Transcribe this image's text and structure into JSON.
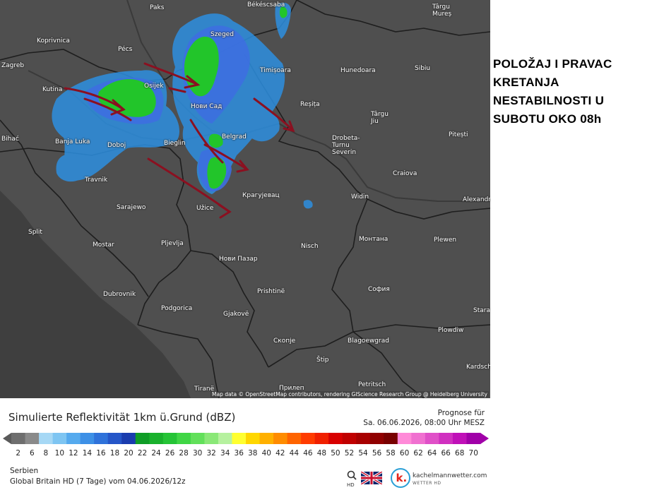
{
  "headline": [
    "POLOŽAJ I PRAVAC",
    "KRETANJA",
    "NESTABILNOSTI U",
    "SUBOTU OKO 08h"
  ],
  "map": {
    "attribution": "Map data © OpenStreetMap contributors, rendering GIScience Research Group @ Heidelberg University",
    "cities": [
      {
        "name": "Paks"
      },
      {
        "name": "Békéscsaba"
      },
      {
        "name": "Târgu Mureș"
      },
      {
        "name": "Koprivnica"
      },
      {
        "name": "Pécs"
      },
      {
        "name": "Szeged"
      },
      {
        "name": "Zagreb"
      },
      {
        "name": "Timișoara"
      },
      {
        "name": "Hunedoara"
      },
      {
        "name": "Sibiu"
      },
      {
        "name": "Kutina"
      },
      {
        "name": "Osijek"
      },
      {
        "name": "Нови Сад"
      },
      {
        "name": "Reșița"
      },
      {
        "name": "Târgu Jiu"
      },
      {
        "name": "Pitești"
      },
      {
        "name": "Bihać"
      },
      {
        "name": "Banja Luka"
      },
      {
        "name": "Doboj"
      },
      {
        "name": "Bieglin"
      },
      {
        "name": "Belgrad"
      },
      {
        "name": "Drobeta-Turnu Severin"
      },
      {
        "name": "Craiova"
      },
      {
        "name": "Travnik"
      },
      {
        "name": "Крагујевац"
      },
      {
        "name": "Widin"
      },
      {
        "name": "Alexandria"
      },
      {
        "name": "Sarajewo"
      },
      {
        "name": "Užice"
      },
      {
        "name": "Split"
      },
      {
        "name": "Mostar"
      },
      {
        "name": "Pljevlja"
      },
      {
        "name": "Nisch"
      },
      {
        "name": "Монтана"
      },
      {
        "name": "Plewen"
      },
      {
        "name": "Нови Пазар"
      },
      {
        "name": "Dubrovnik"
      },
      {
        "name": "Prishtinë"
      },
      {
        "name": "София"
      },
      {
        "name": "Podgorica"
      },
      {
        "name": "Gjakovë"
      },
      {
        "name": "Stara"
      },
      {
        "name": "Plowdiw"
      },
      {
        "name": "Скопје"
      },
      {
        "name": "Blagoewgrad"
      },
      {
        "name": "Štip"
      },
      {
        "name": "Kardsch"
      },
      {
        "name": "Tiranë"
      },
      {
        "name": "Прилеп"
      },
      {
        "name": "Petritsch"
      }
    ]
  },
  "legend": {
    "title": "Simulierte Reflektivität 1km ü.Grund (dBZ)",
    "forecast_label": "Prognose für",
    "forecast_time": "Sa. 06.06.2026, 08:00 Uhr MESZ",
    "ticks": [
      "2",
      "6",
      "8",
      "10",
      "12",
      "14",
      "16",
      "18",
      "20",
      "22",
      "24",
      "26",
      "28",
      "30",
      "32",
      "34",
      "36",
      "38",
      "40",
      "42",
      "44",
      "46",
      "48",
      "50",
      "52",
      "54",
      "56",
      "58",
      "60",
      "62",
      "64",
      "66",
      "68",
      "70"
    ],
    "colors": [
      "#6e6e6e",
      "#8a8a8a",
      "#a6d8f5",
      "#7ec5f2",
      "#55aaee",
      "#3d90e6",
      "#2f72da",
      "#2556c8",
      "#1a3cae",
      "#0f9d26",
      "#19b12c",
      "#25c436",
      "#40d645",
      "#62e05a",
      "#8ae877",
      "#b6f19f",
      "#ffff30",
      "#ffd700",
      "#ffb000",
      "#ff8c00",
      "#ff6400",
      "#ff3c00",
      "#f02000",
      "#d80000",
      "#c00000",
      "#a80000",
      "#900000",
      "#780000",
      "#ff8ad8",
      "#f070d0",
      "#e050c8",
      "#d030c0",
      "#c010b8",
      "#a000a8"
    ]
  },
  "footer": {
    "region": "Serbien",
    "model": "Global Britain HD (7 Tage) vom 04.06.2026/12z",
    "hd_label": "HD",
    "brand_name": "kachelmannwetter.com",
    "brand_sub": "WETTER HD"
  }
}
